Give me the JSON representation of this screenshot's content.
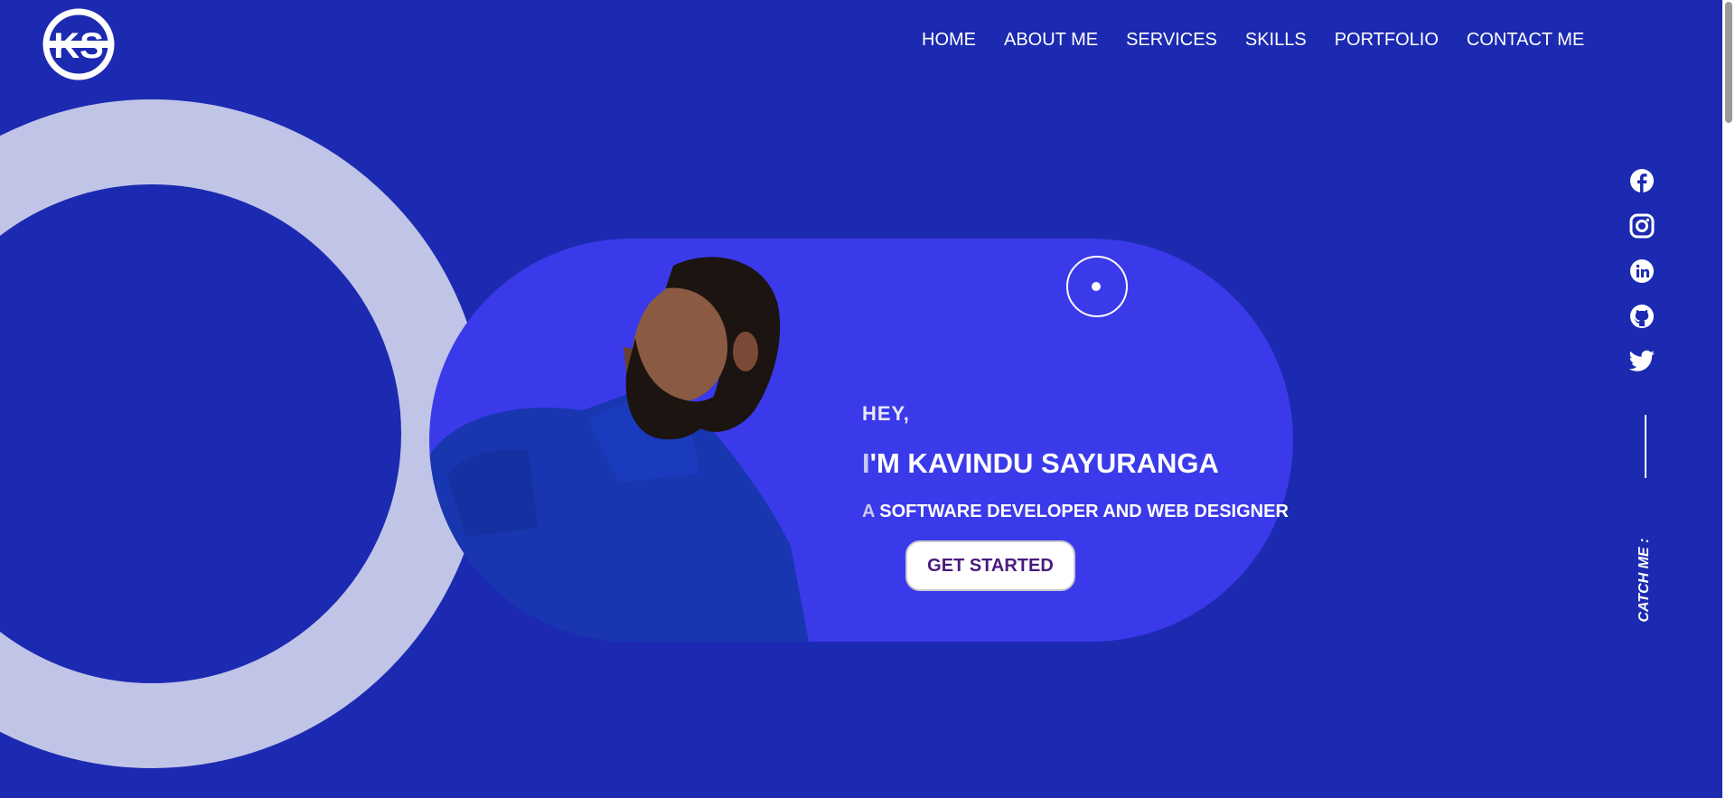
{
  "brand": {
    "logo_icon": "ks-monogram-logo"
  },
  "nav": {
    "items": [
      {
        "label": "HOME"
      },
      {
        "label": "ABOUT ME"
      },
      {
        "label": "SERVICES"
      },
      {
        "label": "SKILLS"
      },
      {
        "label": "PORTFOLIO"
      },
      {
        "label": "CONTACT ME"
      }
    ]
  },
  "hero": {
    "greeting": "HEY,",
    "name_lead": "I",
    "name_rest": "'M KAVINDU SAYURANGA",
    "role_lead": "A",
    "role_rest": " SOFTWARE DEVELOPER AND WEB DESIGNER",
    "cta_label": "GET STARTED"
  },
  "social": {
    "icons": [
      "facebook-icon",
      "instagram-icon",
      "linkedin-icon",
      "github-icon",
      "twitter-icon"
    ],
    "catch_label": "CATCH ME :"
  },
  "colors": {
    "background": "#1c2ab1",
    "card": "#3b3aea",
    "ring": "#c0c5e8",
    "cta_text": "#4a1a7e"
  }
}
